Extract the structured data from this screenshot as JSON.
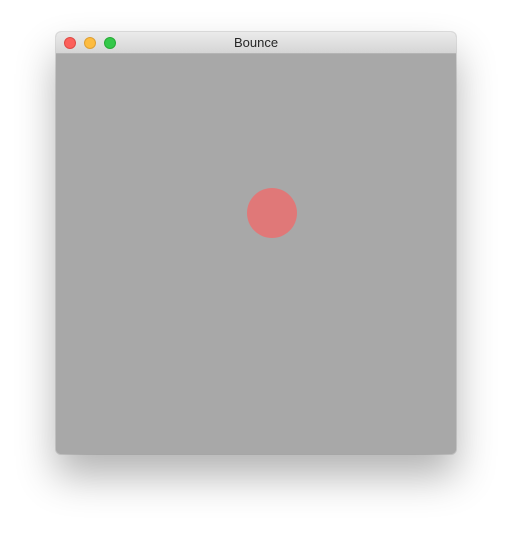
{
  "window": {
    "title": "Bounce"
  },
  "canvas": {
    "background_color": "#a8a8a8",
    "ball": {
      "color": "#e07878"
    }
  },
  "controls": {
    "close": "close-icon",
    "minimize": "minimize-icon",
    "zoom": "zoom-icon"
  }
}
